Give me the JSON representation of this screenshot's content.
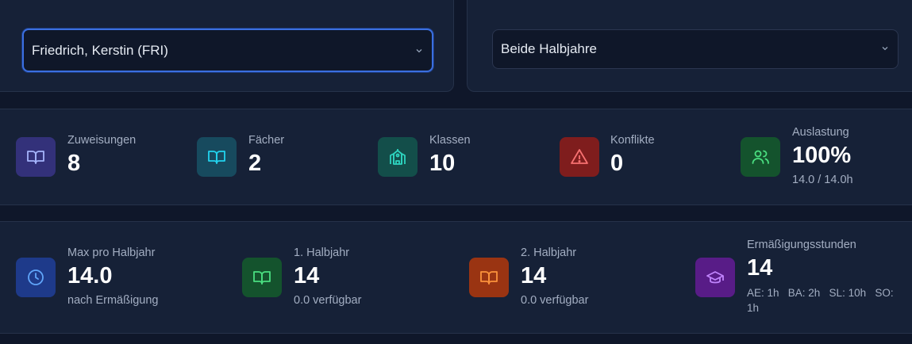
{
  "teacher_select": {
    "value": "Friedrich, Kerstin (FRI)"
  },
  "halbjahr_select": {
    "value": "Beide Halbjahre"
  },
  "stats_row1": [
    {
      "label": "Zuweisungen",
      "value": "8",
      "icon": "book-open-icon",
      "color": "#3b3a8f"
    },
    {
      "label": "Fächer",
      "value": "2",
      "icon": "book-open-icon",
      "color": "#164e63"
    },
    {
      "label": "Klassen",
      "value": "10",
      "icon": "school-icon",
      "color": "#115e59"
    },
    {
      "label": "Konflikte",
      "value": "0",
      "icon": "alert-triangle-icon",
      "color": "#7f1d1d"
    },
    {
      "label": "Auslastung",
      "value": "100%",
      "sub": "14.0 / 14.0h",
      "icon": "users-icon",
      "color": "#14532d"
    }
  ],
  "stats_row2": [
    {
      "label": "Max pro Halbjahr",
      "value": "14.0",
      "sub": "nach Ermäßigung",
      "icon": "clock-icon",
      "color": "#1e3a8a"
    },
    {
      "label": "1. Halbjahr",
      "value": "14",
      "sub": "0.0 verfügbar",
      "icon": "book-open-icon",
      "color": "#14532d"
    },
    {
      "label": "2. Halbjahr",
      "value": "14",
      "sub": "0.0 verfügbar",
      "icon": "book-open-icon",
      "color": "#9a3412"
    },
    {
      "label": "Ermäßigungsstunden",
      "value": "14",
      "sub": "AE: 1h   BA: 2h   SL: 10h   SO:",
      "sub2": "1h",
      "icon": "graduation-cap-icon",
      "color": "#581c87"
    }
  ]
}
